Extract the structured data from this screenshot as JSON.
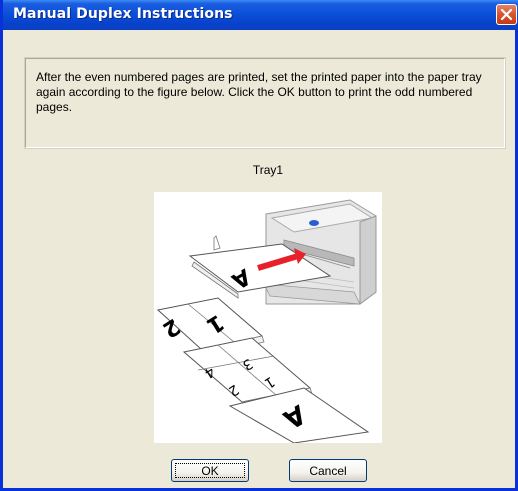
{
  "window": {
    "title": "Manual Duplex Instructions",
    "close_icon": "close-icon"
  },
  "message": {
    "text": "After the even numbered pages are printed, set the printed paper into the paper tray again according to the figure below. Click the OK button to print the odd numbered pages."
  },
  "figure": {
    "label": "Tray1",
    "page_numbers": [
      "2",
      "1",
      "4",
      "3",
      "2",
      "1"
    ],
    "page_letter": "A"
  },
  "buttons": {
    "ok_label": "OK",
    "cancel_label": "Cancel"
  },
  "colors": {
    "title_bar": "#0a50d8",
    "close_button": "#d9542c",
    "dialog_face": "#ece9d8",
    "arrow": "#e8202a"
  }
}
